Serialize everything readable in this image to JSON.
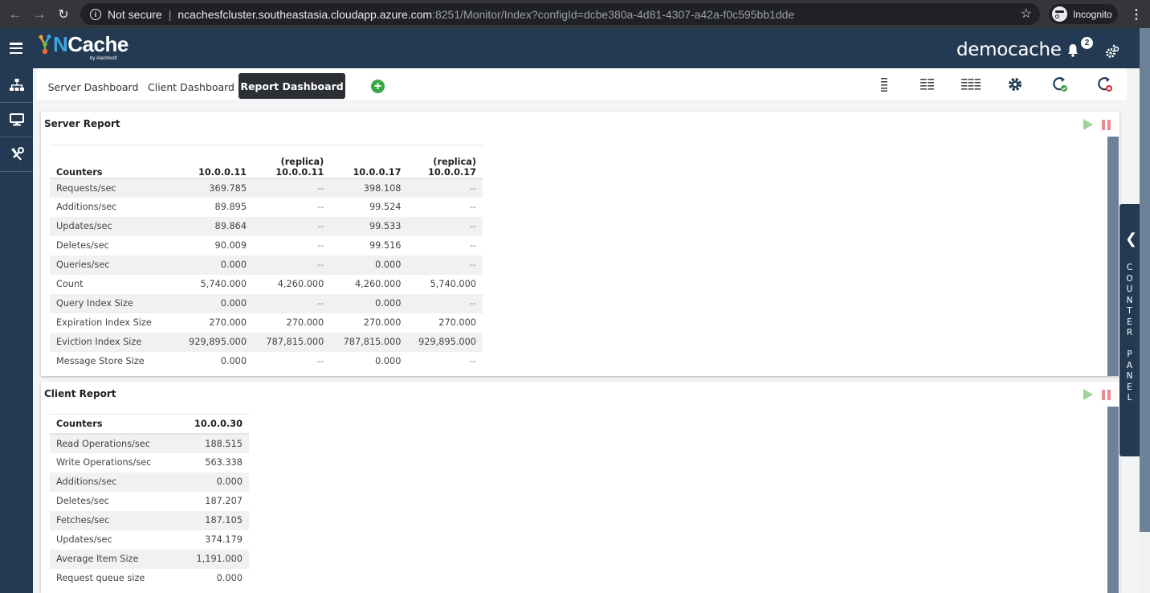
{
  "browser": {
    "security_label": "Not secure",
    "url_host": "ncachesfcluster.southeastasia.cloudapp.azure.com",
    "url_rest": ":8251/Monitor/Index?configId=dcbe380a-4d81-4307-a42a-f0c595bb1dde",
    "profile_label": "Incognito"
  },
  "app": {
    "logo_text_n": "N",
    "logo_text_rest": "Cache",
    "logo_sub": "by Alachisoft",
    "cache_name": "democache",
    "notification_count": "2"
  },
  "sidebar": {
    "items": [
      {
        "icon": "sitemap-icon"
      },
      {
        "icon": "monitor-icon"
      },
      {
        "icon": "tools-icon"
      }
    ]
  },
  "tabs": [
    {
      "label": "Server Dashboard",
      "active": false
    },
    {
      "label": "Client Dashboard",
      "active": false
    },
    {
      "label": "Report Dashboard",
      "active": true
    }
  ],
  "add_tab_label": "+",
  "toolbar": [
    {
      "icon": "one-column-layout-icon"
    },
    {
      "icon": "two-column-layout-icon"
    },
    {
      "icon": "three-column-layout-icon"
    },
    {
      "icon": "settings-gear-icon"
    },
    {
      "icon": "refresh-success-icon"
    },
    {
      "icon": "refresh-stop-icon"
    }
  ],
  "server_report": {
    "title": "Server Report",
    "columns": [
      {
        "top": "",
        "label": "Counters"
      },
      {
        "top": "",
        "label": "10.0.0.11"
      },
      {
        "top": "(replica)",
        "label": "10.0.0.11"
      },
      {
        "top": "",
        "label": "10.0.0.17"
      },
      {
        "top": "(replica)",
        "label": "10.0.0.17"
      }
    ],
    "rows": [
      [
        "Requests/sec",
        "369.785",
        "--",
        "398.108",
        "--"
      ],
      [
        "Additions/sec",
        "89.895",
        "--",
        "99.524",
        "--"
      ],
      [
        "Updates/sec",
        "89.864",
        "--",
        "99.533",
        "--"
      ],
      [
        "Deletes/sec",
        "90.009",
        "--",
        "99.516",
        "--"
      ],
      [
        "Queries/sec",
        "0.000",
        "--",
        "0.000",
        "--"
      ],
      [
        "Count",
        "5,740.000",
        "4,260.000",
        "4,260.000",
        "5,740.000"
      ],
      [
        "Query Index Size",
        "0.000",
        "--",
        "0.000",
        "--"
      ],
      [
        "Expiration Index Size",
        "270.000",
        "270.000",
        "270.000",
        "270.000"
      ],
      [
        "Eviction Index Size",
        "929,895.000",
        "787,815.000",
        "787,815.000",
        "929,895.000"
      ],
      [
        "Message Store Size",
        "0.000",
        "--",
        "0.000",
        "--"
      ]
    ]
  },
  "client_report": {
    "title": "Client Report",
    "columns": [
      {
        "label": "Counters"
      },
      {
        "label": "10.0.0.30"
      }
    ],
    "rows": [
      [
        "Read Operations/sec",
        "188.515"
      ],
      [
        "Write Operations/sec",
        "563.338"
      ],
      [
        "Additions/sec",
        "0.000"
      ],
      [
        "Deletes/sec",
        "187.207"
      ],
      [
        "Fetches/sec",
        "187.105"
      ],
      [
        "Updates/sec",
        "374.179"
      ],
      [
        "Average Item Size",
        "1,191.000"
      ],
      [
        "Request queue size",
        "0.000"
      ]
    ]
  },
  "counter_panel": {
    "label_line1": "COUNTER",
    "label_line2": "PANEL"
  },
  "colors": {
    "header_bg": "#233a52",
    "active_tab_bg": "#2c2f33",
    "add_green": "#3aa845",
    "play_green": "#9ed49b",
    "pause_red": "#e78a8f"
  }
}
